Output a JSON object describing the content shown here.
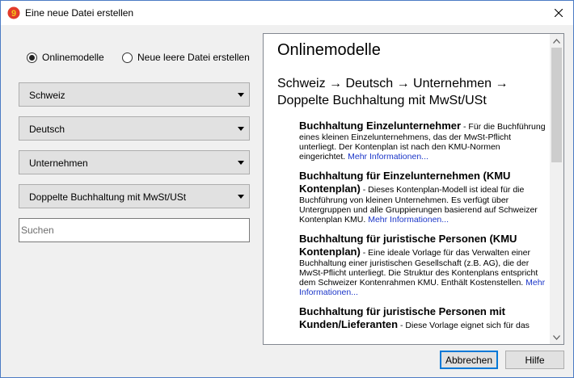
{
  "window": {
    "title": "Eine neue Datei erstellen",
    "accent_color": "#0078d7",
    "app_icon": "banana-app-icon"
  },
  "options": [
    {
      "label": "Onlinemodelle",
      "checked": true
    },
    {
      "label": "Neue leere Datei erstellen",
      "checked": false
    }
  ],
  "filters": [
    {
      "selected": "Schweiz"
    },
    {
      "selected": "Deutsch"
    },
    {
      "selected": "Unternehmen"
    },
    {
      "selected": "Doppelte Buchhaltung mit MwSt/USt"
    }
  ],
  "search": {
    "placeholder": "Suchen",
    "value": ""
  },
  "panel": {
    "title": "Onlinemodelle",
    "breadcrumb": "Schweiz → Deutsch → Unternehmen → Doppelte Buchhaltung mit MwSt/USt",
    "entries": [
      {
        "title": "Buchhaltung Einzelunternehmer",
        "description": " - Für die Buchführung eines kleinen Einzelunternehmens, das der MwSt-Pflicht unterliegt. Der Kontenplan ist nach den KMU-Normen eingerichtet. ",
        "link": "Mehr Informationen..."
      },
      {
        "title": "Buchhaltung für Einzelunternehmen (KMU Kontenplan)",
        "description": " - Dieses Kontenplan-Modell ist ideal für die Buchführung von kleinen Unternehmen. Es verfügt über Untergruppen und alle Gruppierungen basierend auf Schweizer Kontenplan KMU. ",
        "link": "Mehr Informationen..."
      },
      {
        "title": "Buchhaltung für juristische Personen (KMU Kontenplan)",
        "description": " - Eine ideale Vorlage für das Verwalten einer Buchhaltung einer juristischen Gesellschaft (z.B. AG), die der MwSt-Pflicht unterliegt. Die Struktur des Kontenplans entspricht dem Schweizer Kontenrahmen KMU. Enthält Kostenstellen. ",
        "link": "Mehr Informationen..."
      },
      {
        "title": "Buchhaltung für juristische Personen mit Kunden/Lieferanten",
        "description": " - Diese Vorlage eignet sich für das",
        "link": ""
      }
    ]
  },
  "buttons": {
    "ok": "Abbrechen",
    "help": "Hilfe"
  }
}
